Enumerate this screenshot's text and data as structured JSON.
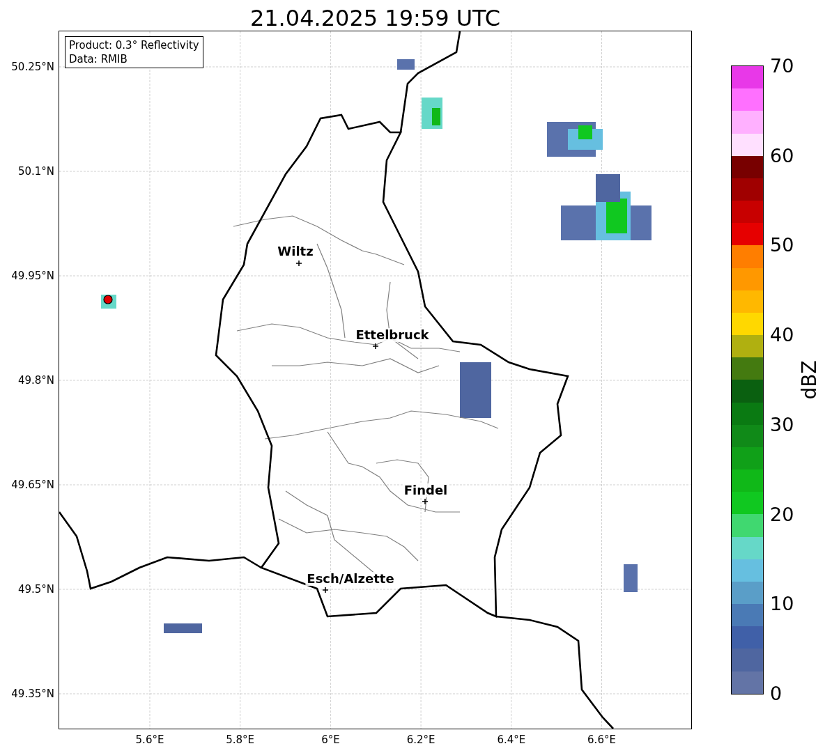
{
  "title": "21.04.2025 19:59 UTC",
  "info_box": {
    "lines": [
      "Product: 0.3° Reflectivity",
      "Data: RMIB"
    ]
  },
  "cities": [
    {
      "label": "Wiltz"
    },
    {
      "label": "Ettelbruck"
    },
    {
      "label": "Findel"
    },
    {
      "label": "Esch/Alzette"
    }
  ],
  "axes": {
    "x_ticks": [
      "5.6°E",
      "5.8°E",
      "6°E",
      "6.2°E",
      "6.4°E",
      "6.6°E"
    ],
    "y_ticks": [
      "50.25°N",
      "50.1°N",
      "49.95°N",
      "49.8°N",
      "49.65°N",
      "49.5°N",
      "49.35°N"
    ]
  },
  "colorbar": {
    "label": "dBZ",
    "ticks": [
      "70",
      "60",
      "50",
      "40",
      "30",
      "20",
      "10",
      "0"
    ],
    "segments": [
      {
        "color": "#e838e8"
      },
      {
        "color": "#ff70ff"
      },
      {
        "color": "#ffb0ff"
      },
      {
        "color": "#ffe0ff"
      },
      {
        "color": "#780000"
      },
      {
        "color": "#a00000"
      },
      {
        "color": "#c80000"
      },
      {
        "color": "#e60000"
      },
      {
        "color": "#ff7e00"
      },
      {
        "color": "#ff9800"
      },
      {
        "color": "#ffb800"
      },
      {
        "color": "#ffd800"
      },
      {
        "color": "#b0b010"
      },
      {
        "color": "#447a10"
      },
      {
        "color": "#0a6010"
      },
      {
        "color": "#0a7a12"
      },
      {
        "color": "#108a18"
      },
      {
        "color": "#10a018"
      },
      {
        "color": "#10b818"
      },
      {
        "color": "#10c820"
      },
      {
        "color": "#40d870"
      },
      {
        "color": "#66d8c8"
      },
      {
        "color": "#66bfe0"
      },
      {
        "color": "#5a9ec8"
      },
      {
        "color": "#4a7ab5"
      },
      {
        "color": "#4060a8"
      },
      {
        "color": "#4f66a0"
      },
      {
        "color": "#6374a6"
      }
    ]
  }
}
